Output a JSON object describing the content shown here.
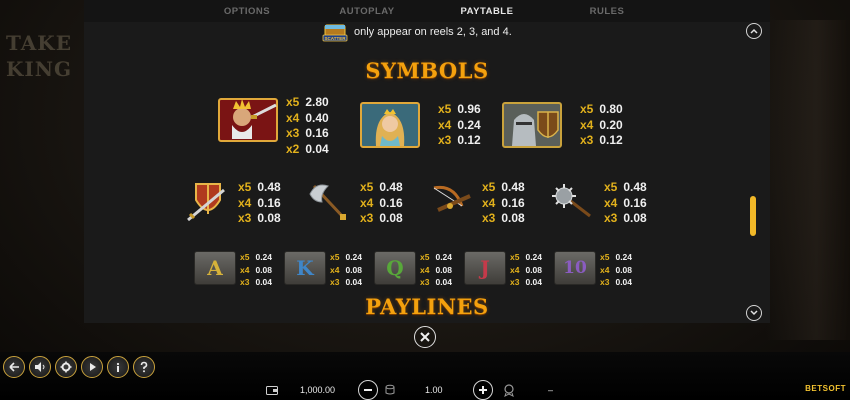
{
  "tabs": [
    {
      "label": "OPTIONS",
      "active": false
    },
    {
      "label": "AUTOPLAY",
      "active": false
    },
    {
      "label": "PAYTABLE",
      "active": true
    },
    {
      "label": "RULES",
      "active": false
    }
  ],
  "scatter_note": "only appear on reels 2, 3, and 4.",
  "symbols_title": "SYMBOLS",
  "paylines_title": "PAYLINES",
  "bg_logo": "TAKE KING",
  "high_symbols": [
    {
      "name": "king",
      "pays": [
        [
          "x5",
          "2.80"
        ],
        [
          "x4",
          "0.40"
        ],
        [
          "x3",
          "0.16"
        ],
        [
          "x2",
          "0.04"
        ]
      ]
    },
    {
      "name": "queen",
      "pays": [
        [
          "x5",
          "0.96"
        ],
        [
          "x4",
          "0.24"
        ],
        [
          "x3",
          "0.12"
        ]
      ]
    },
    {
      "name": "knight",
      "pays": [
        [
          "x5",
          "0.80"
        ],
        [
          "x4",
          "0.20"
        ],
        [
          "x3",
          "0.12"
        ]
      ]
    }
  ],
  "mid_symbols": [
    {
      "name": "shield",
      "pays": [
        [
          "x5",
          "0.48"
        ],
        [
          "x4",
          "0.16"
        ],
        [
          "x3",
          "0.08"
        ]
      ]
    },
    {
      "name": "axe",
      "pays": [
        [
          "x5",
          "0.48"
        ],
        [
          "x4",
          "0.16"
        ],
        [
          "x3",
          "0.08"
        ]
      ]
    },
    {
      "name": "crossbow",
      "pays": [
        [
          "x5",
          "0.48"
        ],
        [
          "x4",
          "0.16"
        ],
        [
          "x3",
          "0.08"
        ]
      ]
    },
    {
      "name": "mace",
      "pays": [
        [
          "x5",
          "0.48"
        ],
        [
          "x4",
          "0.16"
        ],
        [
          "x3",
          "0.08"
        ]
      ]
    }
  ],
  "low_symbols": [
    {
      "letter": "A",
      "color": "#d6b23a",
      "pays": [
        [
          "x5",
          "0.24"
        ],
        [
          "x4",
          "0.08"
        ],
        [
          "x3",
          "0.04"
        ]
      ]
    },
    {
      "letter": "K",
      "color": "#3f86c8",
      "pays": [
        [
          "x5",
          "0.24"
        ],
        [
          "x4",
          "0.08"
        ],
        [
          "x3",
          "0.04"
        ]
      ]
    },
    {
      "letter": "Q",
      "color": "#58a83a",
      "pays": [
        [
          "x5",
          "0.24"
        ],
        [
          "x4",
          "0.08"
        ],
        [
          "x3",
          "0.04"
        ]
      ]
    },
    {
      "letter": "J",
      "color": "#c43a4a",
      "pays": [
        [
          "x5",
          "0.24"
        ],
        [
          "x4",
          "0.08"
        ],
        [
          "x3",
          "0.04"
        ]
      ]
    },
    {
      "letter": "10",
      "color": "#8a5cc0",
      "pays": [
        [
          "x5",
          "0.24"
        ],
        [
          "x4",
          "0.08"
        ],
        [
          "x3",
          "0.04"
        ]
      ]
    }
  ],
  "bottom": {
    "balance": "1,000.00",
    "bet": "1.00",
    "win": "–",
    "logo": "BETSOFT"
  },
  "colors": {
    "accent": "#f4a10e",
    "multiplier": "#e2b11c",
    "panel": "#1a1a1a"
  }
}
